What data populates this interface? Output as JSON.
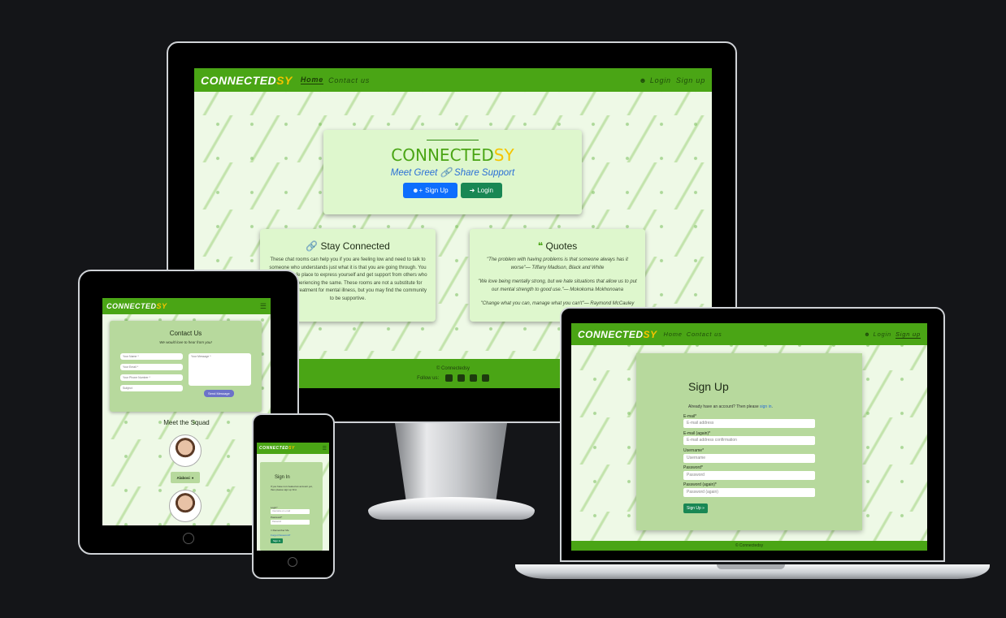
{
  "brand": {
    "main": "CONNECTED",
    "accent": "SY"
  },
  "colors": {
    "nav_green": "#4aa515",
    "brand_yellow": "#f5c400",
    "card_green": "#def7cd",
    "btn_blue": "#0d6efd",
    "btn_green": "#198754"
  },
  "desktop": {
    "nav": {
      "home": "Home",
      "contact": "Contact us",
      "login": "Login",
      "signup": "Sign up"
    },
    "hero": {
      "tagline": "Meet Greet",
      "tagline_2": "Share Support",
      "signup_btn": "Sign Up",
      "login_btn": "Login"
    },
    "stay_connected": {
      "title": "Stay Connected",
      "body": "These chat rooms can help you if you are feeling low and need to talk to someone who understands just what it is that you are going through. You can find a safe place to express yourself and get support from others who are also experiencing the same. These rooms are not a substitute for professional treatment for mental illness, but you may find the community to be supportive."
    },
    "quotes": {
      "title": "Quotes",
      "items": [
        "\"The problem with having problems is that someone always has it worse\"— Tiffany Madison, Black and White",
        "\"We love being mentally strong, but we hate situations that allow us to put our mental strength to good use.\"— Mokokoma Mokhonoana",
        "\"Change what you can, manage what you can't\"— Raymond McCauley"
      ]
    },
    "footer": {
      "copyright": "© Connectedsy",
      "follow": "Follow us:"
    }
  },
  "tablet": {
    "contact": {
      "title": "Contact Us",
      "subtitle": "We would love to hear from you!",
      "name_ph": "Your Name *",
      "email_ph": "Your Email *",
      "phone_ph": "Your Phone Number *",
      "subject_ph": "Subject",
      "message_ph": "Your Message *",
      "send": "Send Message"
    },
    "squad_title": "Meet the Squad",
    "member": "Alabosi"
  },
  "phone": {
    "signin": {
      "title": "Sign In",
      "text": "If you have not created an account yet, then please sign up first.",
      "login_label": "Login*",
      "login_ph": "Username or e-mail",
      "password_label": "Password*",
      "password_ph": "Password",
      "remember": "Remember Me",
      "forgot": "Forgot Password?",
      "btn": "Sign In"
    }
  },
  "laptop": {
    "nav": {
      "home": "Home",
      "contact": "Contact us",
      "login": "Login",
      "signup": "Sign up"
    },
    "signup": {
      "title": "Sign Up",
      "have_account": "Already have an account? Then please",
      "signin_link": "sign in",
      "email_label": "E-mail*",
      "email_ph": "E-mail address",
      "email2_label": "E-mail (again)*",
      "email2_ph": "E-mail address confirmation",
      "username_label": "Username*",
      "username_ph": "Username",
      "password_label": "Password*",
      "password_ph": "Password",
      "password2_label": "Password (again)*",
      "password2_ph": "Password (again)",
      "btn": "Sign Up »"
    },
    "footer": "© Connectedsy"
  }
}
